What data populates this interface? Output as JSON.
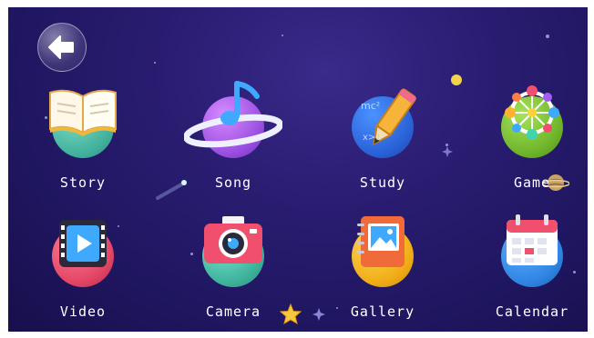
{
  "apps": [
    {
      "label": "Story",
      "icon": "book-icon"
    },
    {
      "label": "Song",
      "icon": "music-note-icon"
    },
    {
      "label": "Study",
      "icon": "pencil-icon"
    },
    {
      "label": "Game",
      "icon": "ferris-wheel-icon"
    },
    {
      "label": "Video",
      "icon": "play-film-icon"
    },
    {
      "label": "Camera",
      "icon": "camera-icon"
    },
    {
      "label": "Gallery",
      "icon": "picture-book-icon"
    },
    {
      "label": "Calendar",
      "icon": "calendar-icon"
    }
  ],
  "back": {
    "icon": "back-arrow-icon"
  },
  "colors": {
    "background": "#241866",
    "story_planet": "#5fc7b3",
    "song_planet": "#a15ae0",
    "study_planet": "#2a6ee0",
    "game_planet": "#7bc234",
    "video_planet": "#e84a6a",
    "camera_planet": "#4cc6b0",
    "gallery_planet": "#f2b61c",
    "calendar_planet": "#2f8be6"
  }
}
